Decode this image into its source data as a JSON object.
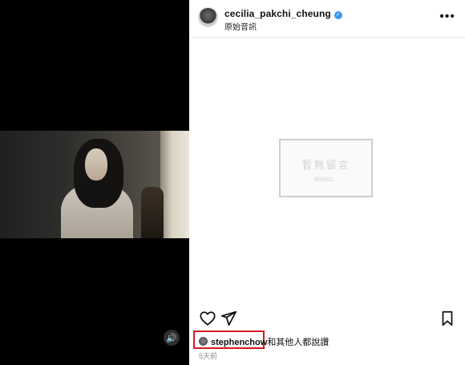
{
  "post": {
    "username": "cecilia_pakchi_cheung",
    "audio_label": "原始音訊",
    "more_glyph": "•••",
    "placeholder_title": "暫無留言",
    "placeholder_sub": "開始對話。"
  },
  "media": {
    "sound_glyph": "🔊"
  },
  "likes": {
    "user": "stephenchow",
    "rest": "和其他人都說讚"
  },
  "timestamp": "5天前",
  "colors": {
    "verified": "#3897f0",
    "highlight_border": "#d71921"
  },
  "icons": [
    "heart-icon",
    "share-icon",
    "bookmark-icon",
    "verified-icon",
    "more-icon",
    "sound-icon"
  ]
}
